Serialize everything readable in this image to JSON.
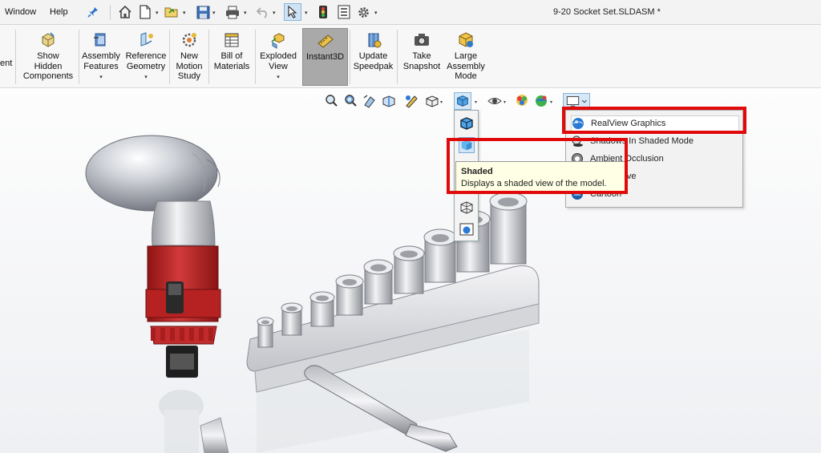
{
  "menubar": {
    "items": [
      "Window",
      "Help"
    ],
    "document_title": "9-20 Socket Set.SLDASM *"
  },
  "command_manager": {
    "partial_label": "ent",
    "commands": [
      {
        "label": "Show\nHidden\nComponents",
        "has_dropdown": false,
        "active": false
      },
      {
        "label": "Assembly\nFeatures",
        "has_dropdown": true,
        "active": false
      },
      {
        "label": "Reference\nGeometry",
        "has_dropdown": true,
        "active": false
      },
      {
        "label": "New\nMotion\nStudy",
        "has_dropdown": false,
        "active": false
      },
      {
        "label": "Bill of\nMaterials",
        "has_dropdown": false,
        "active": false
      },
      {
        "label": "Exploded\nView",
        "has_dropdown": true,
        "active": false
      },
      {
        "label": "Instant3D",
        "has_dropdown": false,
        "active": true
      },
      {
        "label": "Update\nSpeedpak",
        "has_dropdown": false,
        "active": false
      },
      {
        "label": "Take\nSnapshot",
        "has_dropdown": false,
        "active": false
      },
      {
        "label": "Large\nAssembly\nMode",
        "has_dropdown": false,
        "active": false
      }
    ],
    "dropdown_glyph": "▾"
  },
  "heads_up_toolbar": {
    "icons": [
      "zoom-to-fit-icon",
      "zoom-to-area-icon",
      "previous-view-icon",
      "section-view-icon",
      "dynamic-annotation-icon",
      "view-orientation-icon",
      "display-style-icon",
      "hide-show-items-icon",
      "edit-appearance-icon",
      "apply-scene-icon",
      "view-settings-icon"
    ]
  },
  "display_style_flyout": {
    "items": [
      "shaded-with-edges-icon",
      "shaded-icon",
      "hidden-lines-removed-icon",
      "wireframe-icon",
      "shaded-view-icon"
    ]
  },
  "tooltip": {
    "title": "Shaded",
    "description": "Displays a shaded view of the model."
  },
  "view_settings_menu": {
    "items": [
      {
        "label": "RealView Graphics",
        "highlighted": true
      },
      {
        "label": "Shadows In Shaded Mode",
        "highlighted": false
      },
      {
        "label": "Ambient Occlusion",
        "highlighted": false
      },
      {
        "label": "Perspective",
        "highlighted": false
      },
      {
        "label": "Cartoon",
        "highlighted": false
      }
    ]
  },
  "colors": {
    "annotation_red": "#e10a0a",
    "handle_red": "#b81f1f",
    "accent_blue": "#2a7ad4"
  }
}
